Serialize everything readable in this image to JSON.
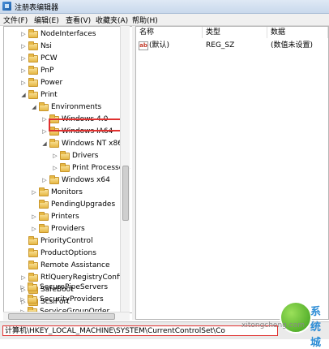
{
  "window": {
    "title": "注册表编辑器"
  },
  "menu": [
    "文件(F)",
    "编辑(E)",
    "查看(V)",
    "收藏夹(A)",
    "帮助(H)"
  ],
  "tree": [
    {
      "label": "NodeInterfaces",
      "arrow": "▷"
    },
    {
      "label": "Nsi",
      "arrow": "▷"
    },
    {
      "label": "PCW",
      "arrow": "▷"
    },
    {
      "label": "PnP",
      "arrow": "▷"
    },
    {
      "label": "Power",
      "arrow": "▷"
    },
    {
      "label": "Print",
      "arrow": "◢"
    },
    {
      "label": "Environments",
      "arrow": "◢"
    },
    {
      "label": "Windows 4.0",
      "arrow": "▷"
    },
    {
      "label": "Windows IA64",
      "arrow": "▷"
    },
    {
      "label": "Windows NT x86",
      "arrow": "◢"
    },
    {
      "label": "Drivers",
      "arrow": "▷"
    },
    {
      "label": "Print Processors",
      "arrow": "▷"
    },
    {
      "label": "Windows x64",
      "arrow": "▷"
    },
    {
      "label": "Monitors",
      "arrow": "▷"
    },
    {
      "label": "PendingUpgrades",
      "arrow": ""
    },
    {
      "label": "Printers",
      "arrow": "▷"
    },
    {
      "label": "Providers",
      "arrow": "▷"
    },
    {
      "label": "PriorityControl",
      "arrow": ""
    },
    {
      "label": "ProductOptions",
      "arrow": ""
    },
    {
      "label": "Remote Assistance",
      "arrow": ""
    },
    {
      "label": "RtlQueryRegistryConfig",
      "arrow": "▷"
    },
    {
      "label": "SafeBoot",
      "arrow": "▷"
    },
    {
      "label": "ScsiPort",
      "arrow": "▷"
    },
    {
      "label": "SecurePipeServers",
      "arrow": "▷"
    },
    {
      "label": "SecurityProviders",
      "arrow": "▷"
    },
    {
      "label": "ServiceGroupOrder",
      "arrow": "▷"
    }
  ],
  "values_pane": {
    "columns": [
      "名称",
      "类型",
      "数据"
    ],
    "rows": [
      {
        "icon": "ab",
        "name": "(默认)",
        "type": "REG_SZ",
        "data": "(数值未设置)"
      }
    ]
  },
  "status": {
    "path": "计算机\\HKEY_LOCAL_MACHINE\\SYSTEM\\CurrentControlSet\\Co"
  },
  "watermark": {
    "text": "系统城",
    "url": "xitongcheng.com"
  },
  "colors": {
    "highlight": "#e0312f",
    "folder": "#e6b845"
  }
}
